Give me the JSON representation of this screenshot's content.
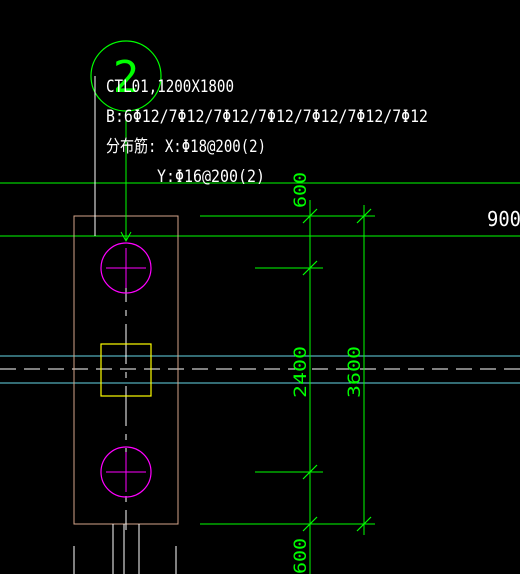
{
  "colors": {
    "background": "#000000",
    "green": "#00ff00",
    "white": "#ffffff",
    "cyan": "#66d9e8",
    "tan": "#d4a58a",
    "magenta": "#ff00ff",
    "yellow": "#ffff00"
  },
  "callout": {
    "bubble_number": "2",
    "line1": "CTL01,1200X1800",
    "line2": "B:6Φ12/7Φ12/7Φ12/7Φ12/7Φ12/7Φ12/7Φ12",
    "line3": "分布筋: X:Φ18@200(2)",
    "line4": "Y:Φ16@200(2)"
  },
  "dimensions": {
    "top": "600",
    "middle": "2400",
    "overall": "3600",
    "bottom": "600",
    "right_partial": "900"
  }
}
